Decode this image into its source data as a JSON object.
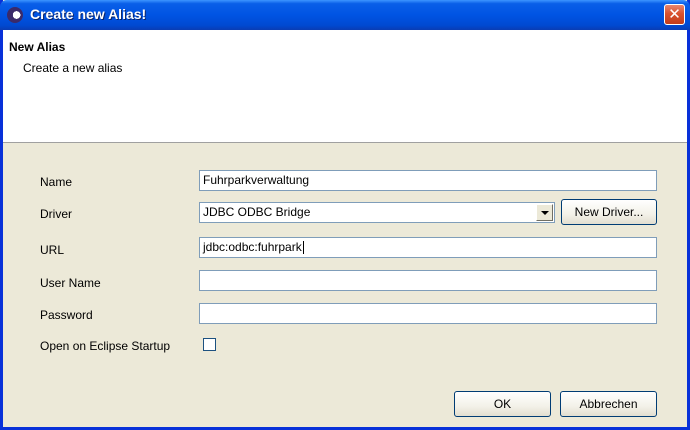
{
  "window": {
    "title": "Create new Alias!",
    "close_glyph": "✕"
  },
  "header": {
    "title": "New Alias",
    "description": "Create a new alias"
  },
  "form": {
    "name_label": "Name",
    "name_value": "Fuhrparkverwaltung",
    "driver_label": "Driver",
    "driver_selected": "JDBC ODBC Bridge",
    "new_driver_label": "New Driver...",
    "url_label": "URL",
    "url_value": "jdbc:odbc:fuhrpark",
    "username_label": "User Name",
    "username_value": "",
    "password_label": "Password",
    "password_value": "",
    "startup_label": "Open on Eclipse Startup",
    "startup_checked": false
  },
  "buttons": {
    "ok_label": "OK",
    "cancel_label": "Abbrechen"
  }
}
